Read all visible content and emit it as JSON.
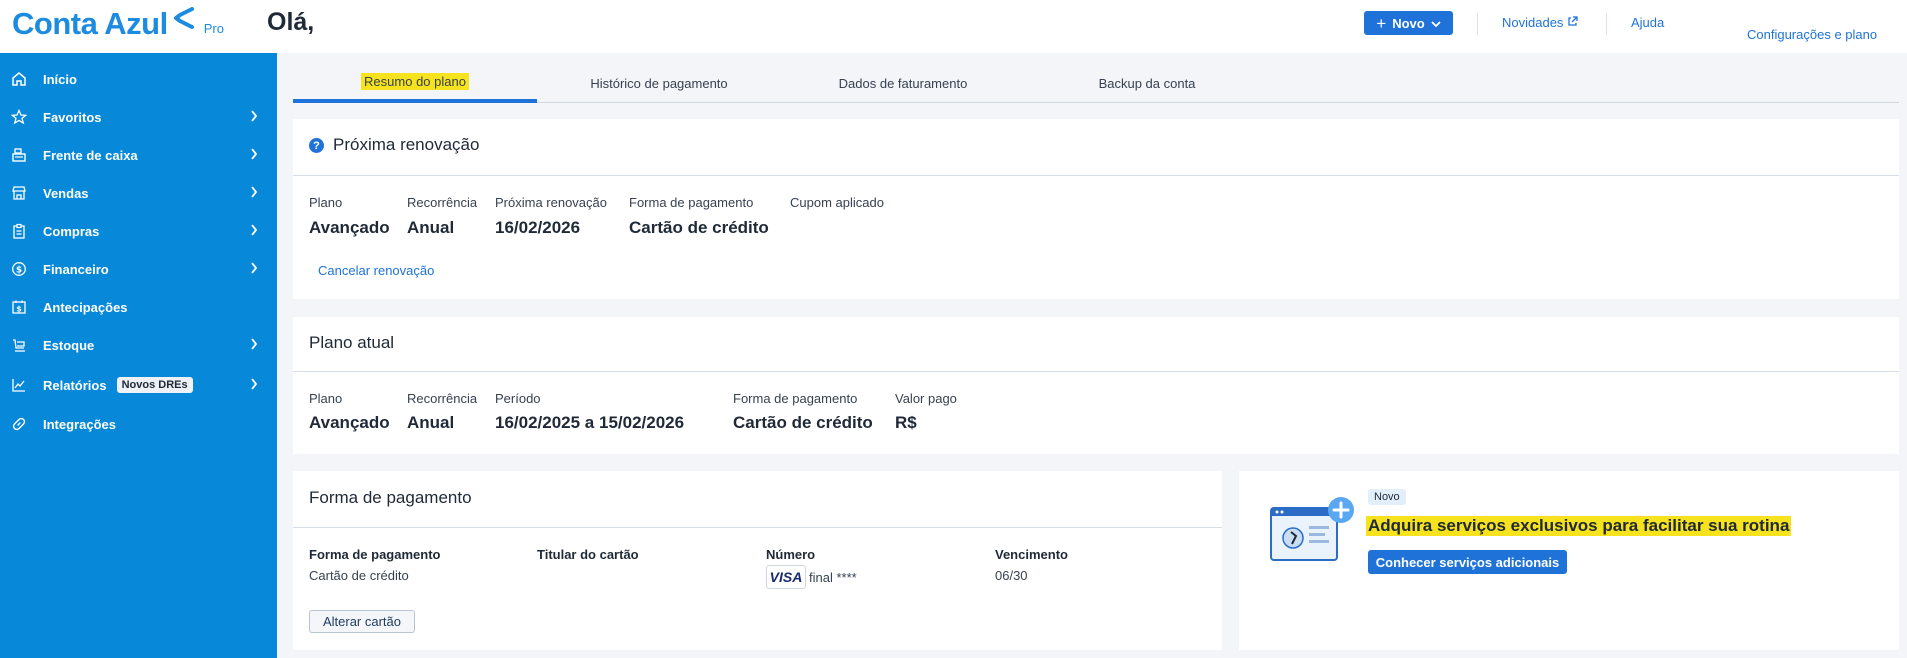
{
  "header": {
    "logo_text": "Conta Azul",
    "logo_suffix": "Pro",
    "greeting": "Olá,",
    "new_button": "Novo",
    "news_link": "Novidades",
    "help_link": "Ajuda",
    "settings_link": "Configurações e plano"
  },
  "sidebar": {
    "items": [
      {
        "label": "Início",
        "icon": "home-icon",
        "chevron": false
      },
      {
        "label": "Favoritos",
        "icon": "star-icon",
        "chevron": true
      },
      {
        "label": "Frente de caixa",
        "icon": "cash-register-icon",
        "chevron": true
      },
      {
        "label": "Vendas",
        "icon": "store-icon",
        "chevron": true
      },
      {
        "label": "Compras",
        "icon": "clipboard-icon",
        "chevron": true
      },
      {
        "label": "Financeiro",
        "icon": "dollar-circle-icon",
        "chevron": true
      },
      {
        "label": "Antecipações",
        "icon": "calendar-dollar-icon",
        "chevron": false
      },
      {
        "label": "Estoque",
        "icon": "box-icon",
        "chevron": true
      },
      {
        "label": "Relatórios",
        "icon": "chart-line-icon",
        "chevron": true,
        "badge": "Novos DREs"
      },
      {
        "label": "Integrações",
        "icon": "link-icon",
        "chevron": false
      }
    ]
  },
  "tabs": [
    {
      "label": "Resumo do plano",
      "active": true
    },
    {
      "label": "Histórico de pagamento",
      "active": false
    },
    {
      "label": "Dados de faturamento",
      "active": false
    },
    {
      "label": "Backup da conta",
      "active": false
    }
  ],
  "renewal": {
    "title": "Próxima renovação",
    "fields": [
      {
        "label": "Plano",
        "value": "Avançado"
      },
      {
        "label": "Recorrência",
        "value": "Anual"
      },
      {
        "label": "Próxima renovação",
        "value": "16/02/2026"
      },
      {
        "label": "Forma de pagamento",
        "value": "Cartão de crédito"
      },
      {
        "label": "Cupom aplicado",
        "value": ""
      }
    ],
    "cancel_link": "Cancelar renovação"
  },
  "current_plan": {
    "title": "Plano atual",
    "fields": [
      {
        "label": "Plano",
        "value": "Avançado"
      },
      {
        "label": "Recorrência",
        "value": "Anual"
      },
      {
        "label": "Período",
        "value": "16/02/2025 a 15/02/2026"
      },
      {
        "label": "Forma de pagamento",
        "value": "Cartão de crédito"
      },
      {
        "label": "Valor pago",
        "value": "R$"
      }
    ]
  },
  "payment": {
    "title": "Forma de pagamento",
    "col_method": "Forma de pagamento",
    "col_holder": "Titular do cartão",
    "col_number": "Número",
    "col_expiry": "Vencimento",
    "method": "Cartão de crédito",
    "holder": "",
    "card_brand": "VISA",
    "number": "final ****",
    "expiry": "06/30",
    "change_button": "Alterar cartão"
  },
  "promo": {
    "badge": "Novo",
    "title": "Adquira serviços exclusivos para facilitar sua rotina",
    "button": "Conhecer serviços adicionais"
  },
  "colors": {
    "sidebar": "#0788d8",
    "primary": "#1f73d8",
    "highlight": "#f7e31d"
  }
}
